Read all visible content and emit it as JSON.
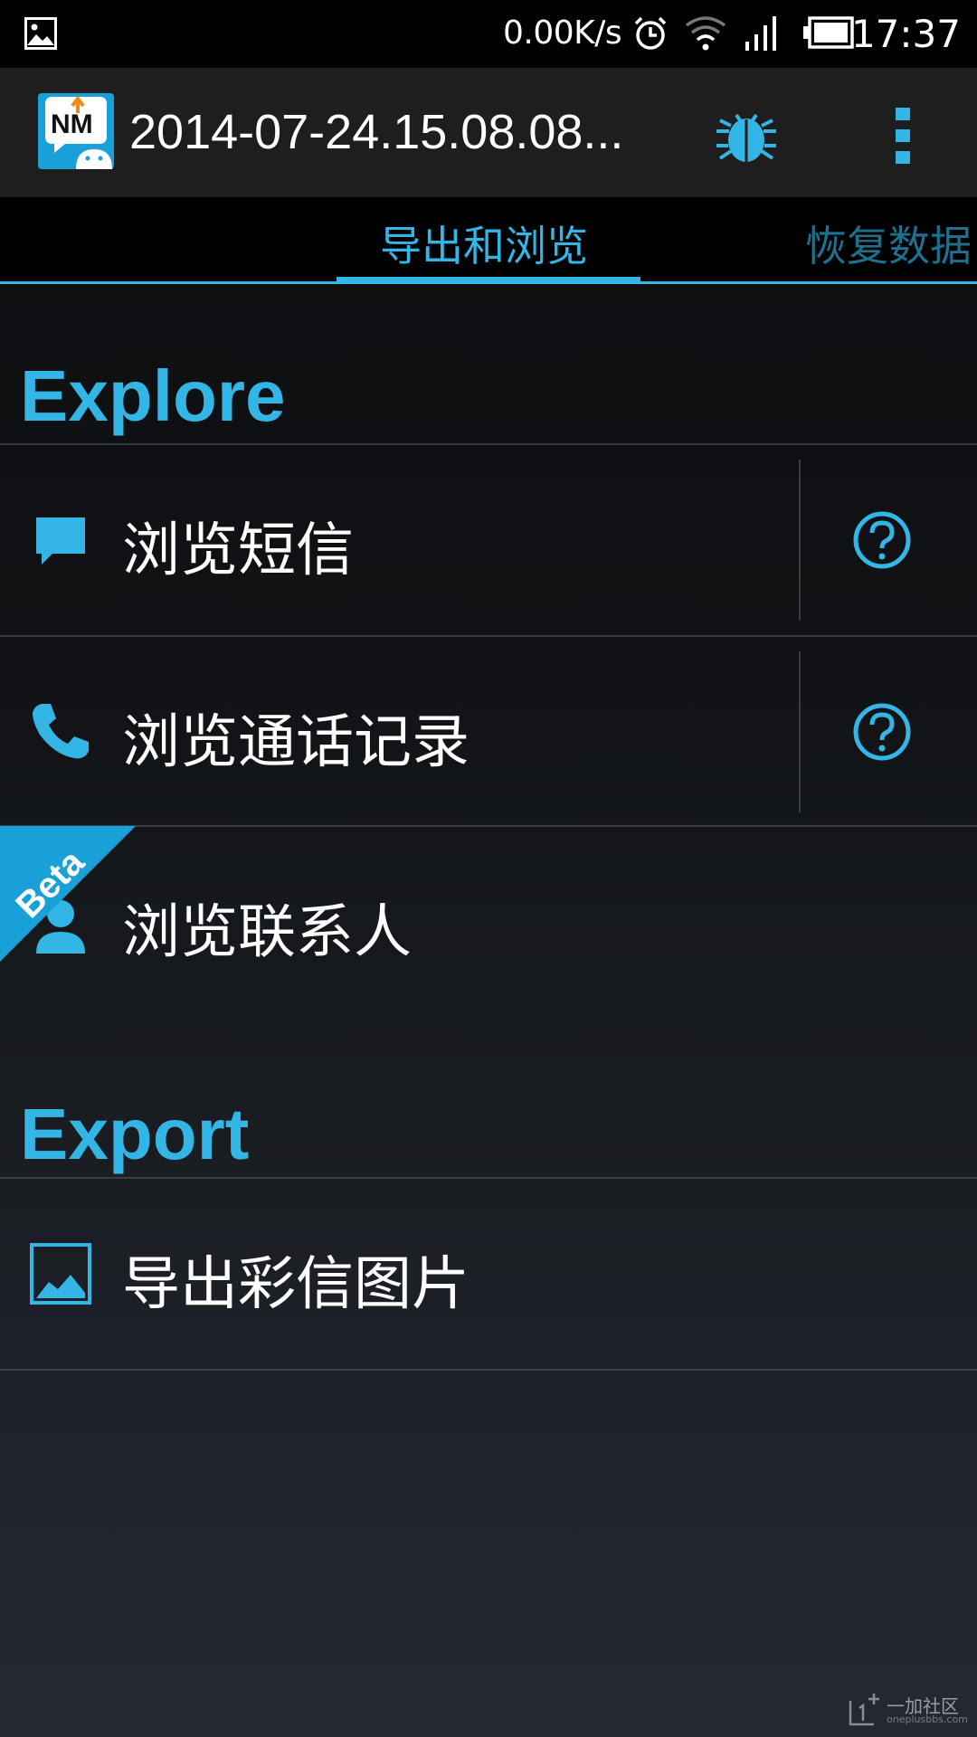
{
  "status_bar": {
    "net_speed": "0.00K/s",
    "time": "17:37",
    "icons": [
      "gallery-icon",
      "alarm-icon",
      "wifi-icon",
      "signal-icon",
      "battery-icon"
    ]
  },
  "action_bar": {
    "title": "2014-07-24.15.08.08...",
    "icons": [
      "app-logo-icon",
      "bug-icon",
      "overflow-menu-icon"
    ]
  },
  "tabs": [
    {
      "label": "导出和浏览",
      "active": true
    },
    {
      "label": "恢复数据",
      "active": false
    }
  ],
  "sections": {
    "explore": {
      "title": "Explore",
      "items": [
        {
          "label": "浏览短信",
          "icon": "message-icon",
          "has_help": true
        },
        {
          "label": "浏览通话记录",
          "icon": "phone-icon",
          "has_help": true
        },
        {
          "label": "浏览联系人",
          "icon": "contact-icon",
          "has_help": false,
          "badge": "Beta"
        }
      ]
    },
    "export": {
      "title": "Export",
      "items": [
        {
          "label": "导出彩信图片",
          "icon": "picture-icon"
        }
      ]
    }
  },
  "watermark": {
    "main": "一加社区",
    "sub": "oneplusbbs.com"
  },
  "colors": {
    "accent": "#33b5e5",
    "accent_dim": "#1f6f8f",
    "action_bar": "#1e1e1e"
  }
}
